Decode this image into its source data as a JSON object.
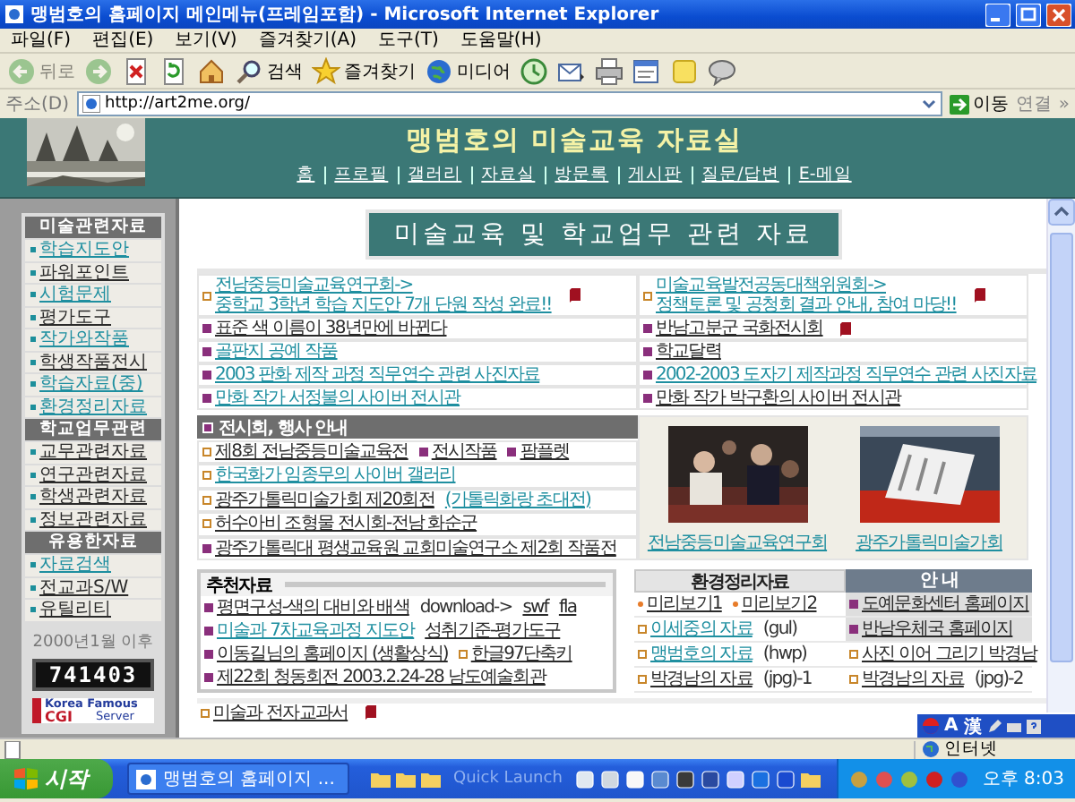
{
  "window": {
    "title": "맹범호의 홈페이지 메인메뉴(프레임포함) - Microsoft Internet Explorer"
  },
  "menu": [
    "파일(F)",
    "편집(E)",
    "보기(V)",
    "즐겨찾기(A)",
    "도구(T)",
    "도움말(H)"
  ],
  "toolbar": [
    {
      "kind": "back",
      "label": "뒤로",
      "disabled": true
    },
    {
      "kind": "forward",
      "disabled": true
    },
    {
      "kind": "stop",
      "disabled": false
    },
    {
      "kind": "refresh",
      "disabled": false
    },
    {
      "kind": "home",
      "disabled": false
    },
    {
      "kind": "search",
      "label": "검색",
      "disabled": false
    },
    {
      "kind": "star",
      "label": "즐겨찾기",
      "disabled": false
    },
    {
      "kind": "media",
      "label": "미디어",
      "disabled": false
    },
    {
      "kind": "history",
      "disabled": false
    },
    {
      "kind": "mail",
      "disabled": false
    },
    {
      "kind": "print",
      "disabled": false
    },
    {
      "kind": "edit",
      "disabled": false
    },
    {
      "kind": "note",
      "disabled": false
    },
    {
      "kind": "messenger",
      "disabled": false
    }
  ],
  "address": {
    "label": "주소(D)",
    "value": "http://art2me.org/",
    "go": "이동",
    "links": "연결",
    "more": "»"
  },
  "site": {
    "title": "맹범호의 미술교육 자료실",
    "nav": [
      "홈",
      "프로필",
      "갤러리",
      "자료실",
      "방문록",
      "게시판",
      "질문/답변",
      "E-메일"
    ]
  },
  "sidebar": {
    "sections": [
      {
        "title": "미술관련자료",
        "items": [
          {
            "label": "학습지도안",
            "visited": false
          },
          {
            "label": "파워포인트",
            "visited": true
          },
          {
            "label": "시험문제",
            "visited": false
          },
          {
            "label": "평가도구",
            "visited": true
          },
          {
            "label": "작가와작품",
            "visited": false
          },
          {
            "label": "학생작품전시",
            "visited": true
          },
          {
            "label": "학습자료(중)",
            "visited": false
          },
          {
            "label": "환경정리자료",
            "visited": false
          }
        ]
      },
      {
        "title": "학교업무관련",
        "items": [
          {
            "label": "교무관련자료",
            "visited": true
          },
          {
            "label": "연구관련자료",
            "visited": true
          },
          {
            "label": "학생관련자료",
            "visited": true
          },
          {
            "label": "정보관련자료",
            "visited": true
          }
        ]
      },
      {
        "title": "유용한자료",
        "items": [
          {
            "label": "자료검색",
            "visited": false
          },
          {
            "label": "전교과S/W",
            "visited": true
          },
          {
            "label": "유틸리티",
            "visited": true
          }
        ]
      }
    ],
    "since": "2000년1월 이후",
    "counter": "741403",
    "badge": [
      "Korea Famous",
      "CGI",
      "Server"
    ]
  },
  "main": {
    "banner": "미술교육 및 학교업무 관련 자료",
    "news": [
      {
        "left": {
          "kind": "outline",
          "text": "전남중등미술교육연구회->",
          "second_line": "중학교 3학년 학습 지도안 7개 단원 작성 완료!!",
          "visited": false,
          "new": true
        },
        "right": {
          "kind": "outline",
          "text": "미술교육발전공동대책위원회->",
          "second_line": "정책토론 및 공청회 결과 안내, 참여 마당!!",
          "visited": false,
          "new": true
        }
      },
      {
        "left": {
          "kind": "filled",
          "text": "표준 색 이름이 38년만에 바뀐다",
          "visited": true
        },
        "right": {
          "kind": "filled",
          "text": "반남고분군 국화전시회",
          "visited": true,
          "new": true
        }
      },
      {
        "left": {
          "kind": "filled",
          "text": "골판지 공예 작품",
          "visited": false
        },
        "right": {
          "kind": "filled",
          "text": "학교달력",
          "visited": true
        }
      },
      {
        "left": {
          "kind": "filled",
          "text": "2003 판화 제작 과정 직무연수 관련 사진자료",
          "visited": false
        },
        "right": {
          "kind": "filled",
          "text": "2002-2003 도자기 제작과정 직무연수 관련 사진자료",
          "visited": false
        }
      },
      {
        "left": {
          "kind": "filled",
          "text": "만화 작가 서정불의 사이버 전시관",
          "visited": false
        },
        "right": {
          "kind": "filled",
          "text": "만화 작가 박구환의 사이버 전시관",
          "visited": true
        }
      }
    ],
    "events": {
      "title": "전시회, 행사 안내",
      "rows": [
        [
          {
            "kind": "outline",
            "text": "제8회 전남중등미술교육전",
            "visited": true
          },
          {
            "kind": "filled",
            "text": "전시작품",
            "visited": true
          },
          {
            "kind": "filled",
            "text": "팜플렛",
            "visited": true
          }
        ],
        [
          {
            "kind": "outline",
            "text": "한국화가 임종무의 사이버 갤러리",
            "visited": false
          }
        ],
        [
          {
            "kind": "outline",
            "text": "광주가톨릭미술가회 제20회전",
            "visited": true
          },
          {
            "kind": "none",
            "text": "(가톨릭화랑 초대전)",
            "visited": false
          }
        ],
        [
          {
            "kind": "outline",
            "text": "허수아비 조형물 전시회-전남 화순군",
            "visited": true
          }
        ],
        [
          {
            "kind": "filled",
            "text": "광주가톨릭대 평생교육원 교회미술연구소 제2회 작품전",
            "visited": true
          }
        ]
      ],
      "photos": [
        {
          "caption": "전남중등미술교육연구회"
        },
        {
          "caption": "광주가톨릭미술가회"
        }
      ]
    },
    "recommended": {
      "title": "추천자료",
      "rows": [
        [
          {
            "kind": "filled",
            "text": "평면구성-색의 대비와 배색",
            "visited": true
          },
          {
            "kind": "none",
            "text": "download->",
            "link": false
          },
          {
            "kind": "none",
            "text": "swf",
            "visited": true
          },
          {
            "kind": "none",
            "text": "fla",
            "visited": true
          }
        ],
        [
          {
            "kind": "filled",
            "text": "미술과 7차교육과정 지도안",
            "visited": false
          },
          {
            "kind": "none",
            "text": "성취기준-평가도구",
            "visited": true
          }
        ],
        [
          {
            "kind": "filled",
            "text": "이동길님의 홈페이지 (생활상식)",
            "visited": true
          },
          {
            "kind": "outline",
            "text": "한글97단축키",
            "visited": true
          }
        ],
        [
          {
            "kind": "filled",
            "text": "제22회 청동회전 2003.2.24-28 남도예술회관",
            "visited": true
          }
        ]
      ]
    },
    "resources": {
      "headers": [
        {
          "label": "환경정리자료",
          "kind": "light"
        },
        {
          "label": "안 내",
          "kind": "dark"
        }
      ],
      "rows": [
        {
          "shaded": true,
          "left": [
            {
              "kind": "dot",
              "text": "미리보기1",
              "visited": true
            },
            {
              "kind": "dot",
              "text": "미리보기2",
              "visited": true
            }
          ],
          "right": [
            {
              "kind": "filled",
              "text": "도예문화센터 홈페이지",
              "visited": true
            }
          ]
        },
        {
          "shaded": true,
          "left": [
            {
              "kind": "outline",
              "text": "이세중의 자료",
              "visited": false
            },
            {
              "kind": "none",
              "text": "(gul)",
              "link": false
            }
          ],
          "right": [
            {
              "kind": "filled",
              "text": "반남우체국 홈페이지",
              "visited": true
            }
          ]
        },
        {
          "shaded": false,
          "left": [
            {
              "kind": "outline",
              "text": "맹범호의 자료",
              "visited": false
            },
            {
              "kind": "none",
              "text": "(hwp)",
              "link": false
            }
          ],
          "right": [
            {
              "kind": "outline",
              "text": "사진 이어 그리기 박경남",
              "visited": true
            }
          ]
        },
        {
          "shaded": false,
          "left": [
            {
              "kind": "outline",
              "text": "박경남의 자료",
              "visited": true
            },
            {
              "kind": "none",
              "text": "(jpg)-1",
              "link": false
            }
          ],
          "right": [
            {
              "kind": "outline",
              "text": "박경남의 자료",
              "visited": true
            },
            {
              "kind": "none",
              "text": "(jpg)-2",
              "link": false
            }
          ]
        }
      ]
    },
    "last_link": {
      "kind": "outline",
      "text": "미술과 전자교과서",
      "visited": true,
      "new": true
    }
  },
  "ime": {
    "mode": "A",
    "hanja": "漢"
  },
  "status_bar": {
    "zone": "인터넷"
  },
  "taskbar": {
    "start": "시작",
    "task": "맹범호의 홈페이지 ...",
    "quick_launch": "Quick Launch",
    "clock": "오후 8:03"
  }
}
